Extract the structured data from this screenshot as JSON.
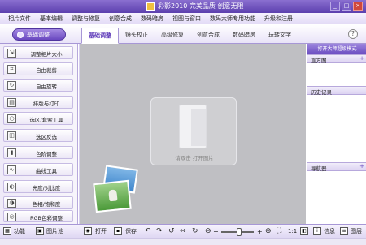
{
  "window": {
    "title": "彩影2010  完美品质  创意无限",
    "controls": [
      "_",
      "□",
      "×"
    ]
  },
  "menu": [
    "相片文件",
    "基本编辑",
    "调整与修复",
    "创意合成",
    "数码暗房",
    "视图与窗口",
    "数码大师专用功能",
    "升级和注册"
  ],
  "toolbar": {
    "basic_adjust_label": "基础调整",
    "tabs": [
      "基础调整",
      "镜头校正",
      "高级修复",
      "创意合成",
      "数码暗房",
      "玩转文字"
    ],
    "active_tab": "基础调整",
    "help": "?"
  },
  "sidebar": {
    "items": [
      {
        "label": "调整相片大小",
        "icon": "resize-icon"
      },
      {
        "label": "自由裁剪",
        "icon": "crop-icon"
      },
      {
        "label": "自由旋转",
        "icon": "rotate-icon"
      },
      {
        "label": "排版与打印",
        "icon": "print-icon"
      },
      {
        "label": "选区/套索工具",
        "icon": "lasso-icon"
      },
      {
        "label": "选区反选",
        "icon": "invert-selection-icon"
      },
      {
        "label": "色阶调整",
        "icon": "levels-icon"
      },
      {
        "label": "曲线工具",
        "icon": "curves-icon"
      },
      {
        "label": "亮度/对比度",
        "icon": "brightness-icon"
      },
      {
        "label": "色相/饱和度",
        "icon": "hue-icon"
      },
      {
        "label": "RGB色彩调整",
        "icon": "rgb-icon"
      }
    ]
  },
  "canvas": {
    "drop_hint": "请双击  打开图片"
  },
  "right_panel": {
    "top_banner": "打开大师超级模式",
    "sections": [
      {
        "label": "直方图",
        "expand": "+"
      },
      {
        "label": "历史记录",
        "expand": ""
      },
      {
        "label": "导航器",
        "expand": "+"
      }
    ]
  },
  "bottombar": {
    "function": "功能",
    "image_pool": "图片池",
    "open": "打开",
    "save": "保存",
    "ratio": "1:1",
    "info": "信息",
    "layers": "图层"
  }
}
